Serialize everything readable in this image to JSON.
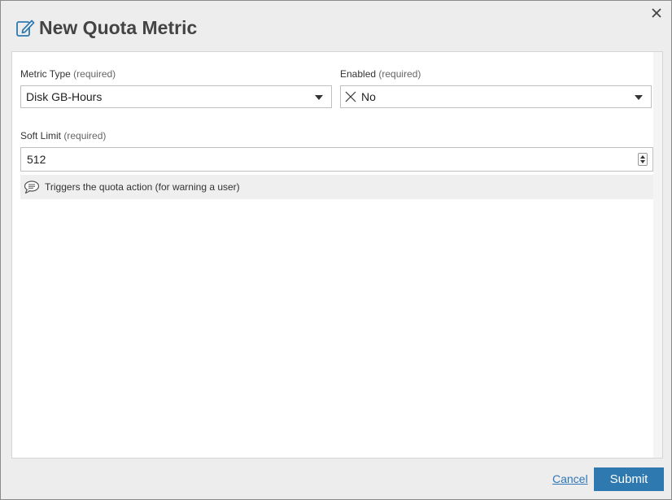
{
  "dialog": {
    "title": "New Quota Metric",
    "title_icon": "pencil-edit-icon",
    "close_icon": "close-icon"
  },
  "form": {
    "metric_type": {
      "label": "Metric Type",
      "required": "(required)",
      "value": "Disk GB-Hours"
    },
    "enabled": {
      "label": "Enabled",
      "required": "(required)",
      "value": "No",
      "value_icon": "x-icon"
    },
    "soft_limit": {
      "label": "Soft Limit",
      "required": "(required)",
      "value": "512"
    },
    "help": {
      "icon": "speech-bubble-icon",
      "text": "Triggers the quota action (for warning a user)"
    }
  },
  "footer": {
    "cancel_label": "Cancel",
    "submit_label": "Submit"
  },
  "colors": {
    "accent": "#2e79b0",
    "link": "#2e77b4",
    "background": "#ededed"
  }
}
